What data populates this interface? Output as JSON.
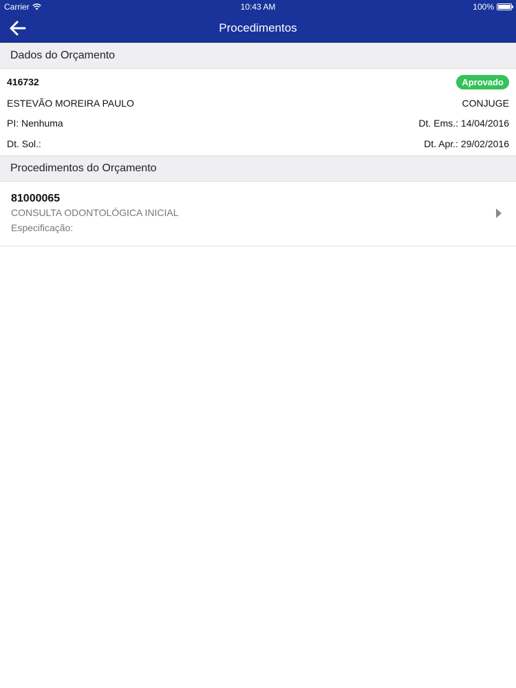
{
  "status": {
    "carrier": "Carrier",
    "time": "10:43 AM",
    "battery": "100%",
    "battery_level": 1.0
  },
  "nav": {
    "title": "Procedimentos",
    "back_icon": "back-arrow-icon"
  },
  "budget_section": {
    "header": "Dados do Orçamento",
    "id": "416732",
    "status": "Aprovado",
    "status_color": "#35c259",
    "patient": "ESTEVÃO MOREIRA PAULO",
    "relation": "CONJUGE",
    "pi": "PI: Nenhuma",
    "dt_ems": "Dt. Ems.: 14/04/2016",
    "dt_sol": "Dt. Sol.:",
    "dt_apr": "Dt. Apr.: 29/02/2016"
  },
  "procedures_section": {
    "header": "Procedimentos do Orçamento",
    "items": [
      {
        "code": "81000065",
        "description": "CONSULTA ODONTOLÓGICA INICIAL",
        "specification": "Especificação:"
      }
    ]
  },
  "colors": {
    "nav_background": "#19339a",
    "section_background": "#efeff2"
  }
}
